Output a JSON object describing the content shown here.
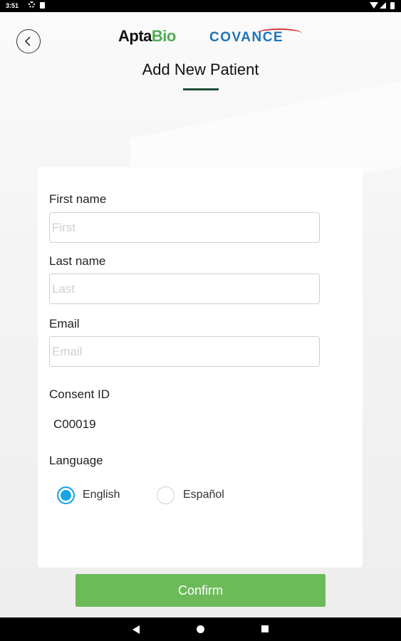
{
  "status_bar": {
    "time": "3:51",
    "icons": [
      "gear-icon",
      "sd-card-icon",
      "wifi-icon",
      "signal-icon",
      "battery-icon"
    ]
  },
  "header": {
    "back_icon": "chevron-left-icon",
    "logo_left_prefix": "Apta",
    "logo_left_suffix": "Bio",
    "logo_right": "COVANCE",
    "title": "Add New Patient"
  },
  "form": {
    "first_name": {
      "label": "First name",
      "placeholder": "First",
      "value": ""
    },
    "last_name": {
      "label": "Last name",
      "placeholder": "Last",
      "value": ""
    },
    "email": {
      "label": "Email",
      "placeholder": "Email",
      "value": ""
    },
    "consent": {
      "label": "Consent ID",
      "value": "C00019"
    },
    "language": {
      "label": "Language",
      "options": [
        {
          "label": "English",
          "selected": true
        },
        {
          "label": "Español",
          "selected": false
        }
      ]
    },
    "confirm_label": "Confirm"
  },
  "colors": {
    "accent_green": "#6dba5a",
    "radio_blue": "#1aa3e8",
    "title_underline": "#1d4d36",
    "covance_blue": "#1f74b8"
  },
  "nav_bar": {
    "icons": [
      "nav-back-icon",
      "nav-home-icon",
      "nav-recents-icon"
    ]
  }
}
